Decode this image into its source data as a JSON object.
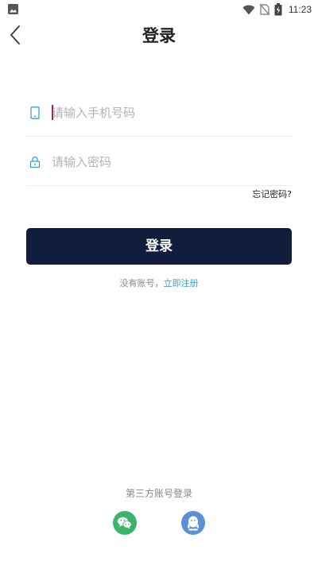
{
  "status_bar": {
    "time": "11:23",
    "icons": [
      "gallery-icon",
      "wifi-icon",
      "no-sim-icon",
      "battery-charging-icon"
    ]
  },
  "header": {
    "title": "登录",
    "back_icon": "back-chevron-icon"
  },
  "form": {
    "phone": {
      "placeholder": "请输入手机号码",
      "value": "",
      "icon": "phone-icon"
    },
    "password": {
      "placeholder": "请输入密码",
      "value": "",
      "icon": "lock-icon"
    },
    "forgot_label": "忘记密码?",
    "login_label": "登录",
    "no_account_text": "没有账号，",
    "register_label": "立即注册"
  },
  "third_party": {
    "title": "第三方账号登录",
    "providers": [
      "wechat-icon",
      "qq-icon"
    ]
  },
  "colors": {
    "primary": "#121c3c",
    "link": "#3ba1d8",
    "icon_accent": "#3ba1d8",
    "wechat": "#3bb36b",
    "qq": "#5b8fd6"
  }
}
